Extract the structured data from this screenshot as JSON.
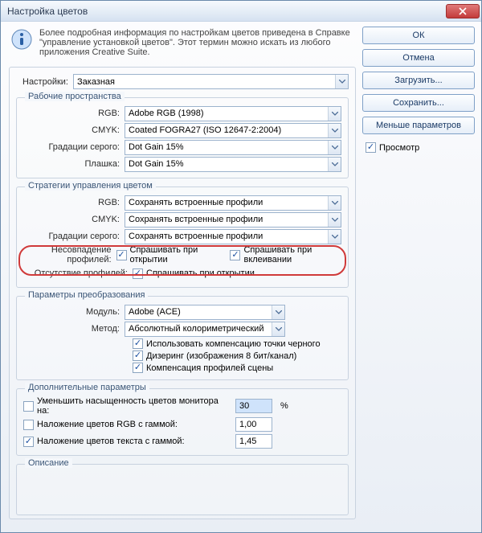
{
  "window": {
    "title": "Настройка цветов"
  },
  "info_text": "Более подробная информация по настройкам цветов приведена в Справке \"управление установкой цветов\". Этот термин можно искать из любого приложения Creative Suite.",
  "settings": {
    "label": "Настройки:",
    "value": "Заказная"
  },
  "workspaces": {
    "legend": "Рабочие пространства",
    "rgb_label": "RGB:",
    "rgb_value": "Adobe RGB (1998)",
    "cmyk_label": "CMYK:",
    "cmyk_value": "Coated FOGRA27 (ISO 12647-2:2004)",
    "gray_label": "Градации серого:",
    "gray_value": "Dot Gain 15%",
    "spot_label": "Плашка:",
    "spot_value": "Dot Gain 15%"
  },
  "policies": {
    "legend": "Стратегии управления цветом",
    "rgb_label": "RGB:",
    "rgb_value": "Сохранять встроенные профили",
    "cmyk_label": "CMYK:",
    "cmyk_value": "Сохранять встроенные профили",
    "gray_label": "Градации серого:",
    "gray_value": "Сохранять встроенные профили",
    "mismatch_label": "Несовпадение профилей:",
    "ask_open": "Спрашивать при открытии",
    "ask_paste": "Спрашивать при вклеивании",
    "missing_label": "Отсутствие профилей:",
    "ask_open2": "Спрашивать при открытии"
  },
  "conversion": {
    "legend": "Параметры преобразования",
    "engine_label": "Модуль:",
    "engine_value": "Adobe (ACE)",
    "intent_label": "Метод:",
    "intent_value": "Абсолютный колориметрический",
    "bpc": "Использовать компенсацию точки черного",
    "dither": "Дизеринг (изображения 8 бит/канал)",
    "scene": "Компенсация профилей сцены"
  },
  "advanced": {
    "legend": "Дополнительные параметры",
    "desat": "Уменьшить насыщенность цветов монитора на:",
    "desat_value": "30",
    "desat_unit": "%",
    "blend_rgb": "Наложение цветов RGB с гаммой:",
    "blend_rgb_value": "1,00",
    "blend_text": "Наложение цветов текста с гаммой:",
    "blend_text_value": "1,45"
  },
  "description": {
    "legend": "Описание"
  },
  "buttons": {
    "ok": "ОК",
    "cancel": "Отмена",
    "load": "Загрузить...",
    "save": "Сохранить...",
    "fewer": "Меньше параметров",
    "preview": "Просмотр"
  }
}
